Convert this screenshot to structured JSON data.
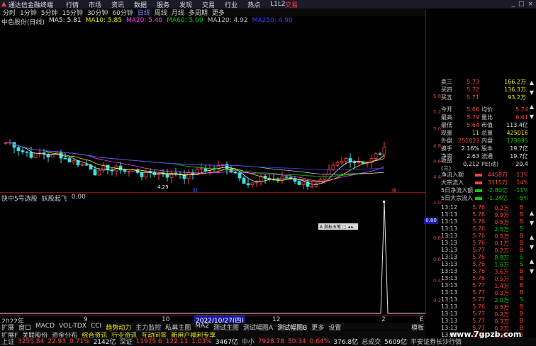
{
  "menubar": {
    "app_title": "通达信金融终端",
    "items": [
      "行情",
      "市场",
      "资讯",
      "数据",
      "服务",
      "发现",
      "交易",
      "行业",
      "热点",
      "L1L2"
    ],
    "trade_label": "交易",
    "window_controls": [
      "_",
      "□",
      "×"
    ]
  },
  "periodbar": {
    "items": [
      "分时",
      "1分钟",
      "5分钟",
      "15分钟",
      "30分钟",
      "60分钟",
      "日线",
      "周线",
      "月线",
      "多周期",
      "更多"
    ],
    "active": "日线"
  },
  "ma_line": {
    "stock": "中色股份(日线)",
    "ma5": "MA5: 5.81",
    "ma10": "MA10: 5.85",
    "ma20": "MA20: 5.40",
    "ma60": "MA60: 5.09",
    "ma120": "MA120: 4.92",
    "ma250": "MA250: 4.90",
    "colors": {
      "ma5": "#e0e0e0",
      "ma10": "#e8e800",
      "ma20": "#ff40ff",
      "ma60": "#00d000",
      "ma120": "#c0c0c0",
      "ma250": "#4040ff"
    }
  },
  "chart_labels": {
    "low_marker": "4.29",
    "event_marker_1": "财",
    "event_marker_2": "涨"
  },
  "price_axis": [
    "5.65",
    "5.20",
    "5.00",
    "4.80",
    "4.65",
    "4.45"
  ],
  "sub_indicator": {
    "name": "快中5号选股",
    "desc": "妖股起飞",
    "value": "0.00",
    "axis": [
      "1.00",
      "0.80",
      "0.60",
      "0.40",
      "0.20"
    ],
    "price_tag": "0.80"
  },
  "float_box": {
    "text": "A 指标五笔 ⬚ ◂ ▸"
  },
  "x_axis": {
    "labels": [
      "2022年",
      "9",
      "10",
      "2022/10/27(四)",
      "12",
      "2",
      "E"
    ]
  },
  "tabs1": [
    "扩展",
    "窗口",
    "MACD",
    "VOL-TDX",
    "CCI",
    "趋势动力",
    "主力监控",
    "私募主图",
    "MA2",
    "测试主图",
    "测试幅图A",
    "测试幅图B",
    "更多",
    "设置"
  ],
  "tabs2": [
    "扩展F",
    "关联股份",
    "资金分布",
    "综合资讯",
    "行业资讯",
    "互动问答",
    "新用户福利专享"
  ],
  "tab_extra": "模板",
  "right_panel": {
    "order_book": [
      {
        "label": "卖三",
        "price": "5.73",
        "vol": "166.2万"
      },
      {
        "label": "买四",
        "price": "5.72",
        "vol": "136.3万"
      },
      {
        "label": "买五",
        "price": "5.71",
        "vol": "93.2万"
      }
    ],
    "stats": [
      {
        "l1": "今开",
        "v1": "5.66",
        "l2": "均价",
        "v2": "5.74"
      },
      {
        "l1": "最高",
        "v1": "5.79",
        "l2": "量比",
        "v2": "6.61"
      },
      {
        "l1": "最低",
        "v1": "5.64",
        "l2": "市值",
        "v2": "113.4亿"
      },
      {
        "l1": "现量",
        "v1": "11",
        "l2": "总量",
        "v2": "425016"
      },
      {
        "l1": "外盘",
        "v1": "251021",
        "l2": "内盘",
        "v2": "173995"
      },
      {
        "l1": "换手",
        "v1": "2.16%",
        "l2": "股本",
        "v2": "19.7亿"
      },
      {
        "l1": "净资",
        "v1": "2.63",
        "l2": "流通",
        "v2": "19.7亿"
      },
      {
        "l1": "收益(三)",
        "v1": "0.212",
        "l2": "PE(动)",
        "v2": "20.4"
      }
    ],
    "flows": [
      {
        "label": "净流入额",
        "value": "4458万",
        "pct": "13%"
      },
      {
        "label": "大宗流入",
        "value": "3315万",
        "pct": "14%"
      },
      {
        "label": "5日净流入额",
        "value": "-2.80亿",
        "pct": "-11%"
      },
      {
        "label": "5日大宗流入",
        "value": "-1.24亿",
        "pct": "-5%"
      }
    ],
    "ticks": [
      {
        "time": "13:12",
        "price": "5.76",
        "vol": "0.2万",
        "side": "B"
      },
      {
        "time": "13:13",
        "price": "5.76",
        "vol": "9.9万",
        "side": "B"
      },
      {
        "time": "13:13",
        "price": "5.76",
        "vol": "0.5万",
        "side": "B"
      },
      {
        "time": "13:13",
        "price": "5.76",
        "vol": "2.5万",
        "side": "S"
      },
      {
        "time": "13:13",
        "price": "5.76",
        "vol": "0.5万",
        "side": "B"
      },
      {
        "time": "13:13",
        "price": "5.76",
        "vol": "0.1万",
        "side": "B"
      },
      {
        "time": "13:13",
        "price": "5.77",
        "vol": "0.2万",
        "side": "B"
      },
      {
        "time": "13:13",
        "price": "5.76",
        "vol": "8.8万",
        "side": "S"
      },
      {
        "time": "13:13",
        "price": "5.76",
        "vol": "1.6万",
        "side": "S"
      },
      {
        "time": "13:13",
        "price": "5.76",
        "vol": "3.6万",
        "side": "B"
      },
      {
        "time": "13:13",
        "price": "5.76",
        "vol": "0.5万",
        "side": "B"
      },
      {
        "time": "13:13",
        "price": "5.77",
        "vol": "1.4万",
        "side": "B"
      },
      {
        "time": "13:13",
        "price": "5.77",
        "vol": "0.3万",
        "side": "B"
      },
      {
        "time": "13:13",
        "price": "5.77",
        "vol": "2.0万",
        "side": "S"
      },
      {
        "time": "13:13",
        "price": "5.76",
        "vol": "0.5万",
        "side": "B"
      },
      {
        "time": "13:13",
        "price": "5.77",
        "vol": "0.2万",
        "side": "B"
      },
      {
        "time": "13:13",
        "price": "5.77",
        "vol": "0.3万",
        "side": "B"
      },
      {
        "time": "13:13",
        "price": "5.77",
        "vol": "0.2万",
        "side": "B"
      },
      {
        "time": "13:13",
        "price": "5.76",
        "vol": "0.2万",
        "side": "B"
      }
    ]
  },
  "status": {
    "sh_label": "上证",
    "sh_val": "3255.84",
    "sh_chg": "22.93",
    "sh_pct": "0.71%",
    "sh_amt": "2142亿",
    "sz_label": "深证",
    "sz_val": "11975.6",
    "sz_chg": "122.11",
    "sz_pct": "1.03%",
    "sz_amt": "3467亿",
    "zx_label": "中小",
    "zx_val": "7928.78",
    "zx_chg": "50.34",
    "zx_pct": "0.64%",
    "zx_amt": "376.8亿",
    "total_label": "总成交",
    "total_val": "5609亿",
    "note": "平安证券长沙行情"
  },
  "watermark": "www.7gpzb.com"
}
